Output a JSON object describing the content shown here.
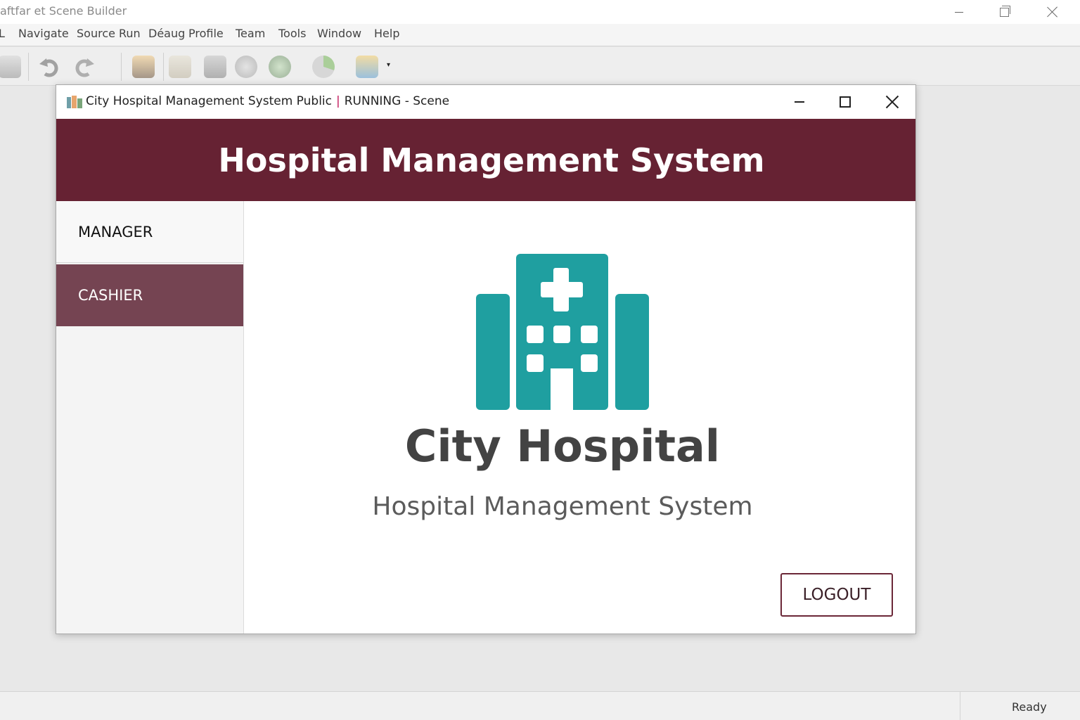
{
  "ide": {
    "title": "aftfar et Scene Builder",
    "menu": [
      "L",
      "Navigate",
      "Source",
      "Run",
      "Déaug",
      "Profile",
      "Team",
      "Tools",
      "Window",
      "Help"
    ],
    "toolbar_icons": [
      "printer-icon",
      "undo-icon",
      "redo-icon",
      "clean-build-icon",
      "file-icon",
      "library-icon",
      "gear-icon",
      "run-settings-icon",
      "profiler-icon",
      "app-icon"
    ]
  },
  "app": {
    "window_title": "City Hospital Management System Public",
    "window_status": "RUNNING - Scene",
    "title_separator": "|",
    "header_title": "Hospital Management System",
    "sidebar": [
      {
        "label": "MANAGER",
        "selected": false
      },
      {
        "label": "CASHIER",
        "selected": true
      }
    ],
    "content": {
      "name": "City Hospital",
      "subtitle": "Hospital Management System",
      "logout_label": "LOGOUT"
    },
    "colors": {
      "header": "#662233",
      "selected_item": "#754452",
      "logo": "#1f9fa0",
      "logout_border": "#6b2737"
    }
  },
  "status": {
    "text": "Ready"
  }
}
